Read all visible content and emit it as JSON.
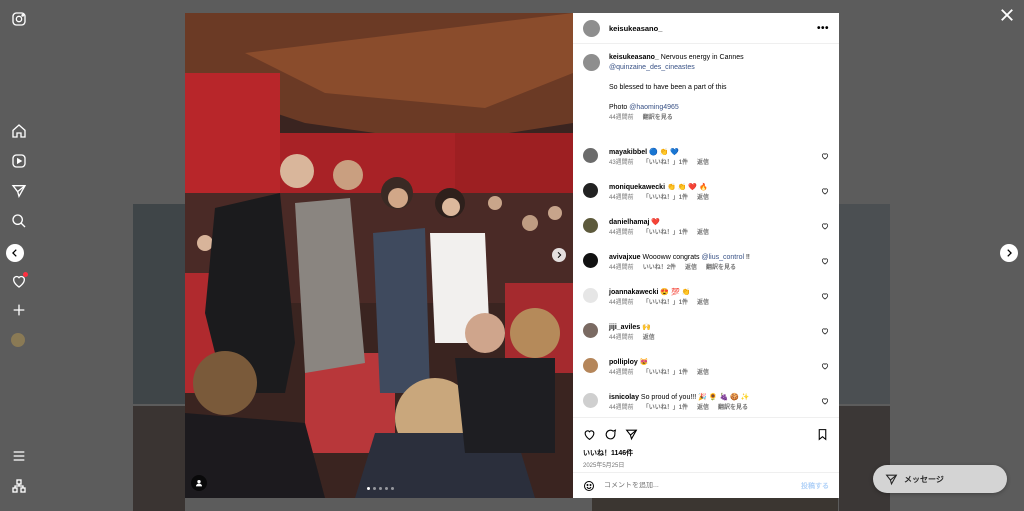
{
  "post": {
    "username": "keisukeasano_",
    "caption_lead": "Nervous energy in Cannes",
    "caption_mention": "@quinzaine_des_cineastes",
    "caption_line2": "So blessed to have been a part of this",
    "caption_photo_label": "Photo",
    "caption_photo_mention": "@haoming4965",
    "caption_time": "44週間前",
    "caption_translate": "翻訳を見る",
    "likes": "いいね！1146件",
    "date": "2025年5月25日"
  },
  "comments": [
    {
      "user": "mayakibbel",
      "text": "🔵 👏 💙",
      "time": "43週間前",
      "likes": "「いいね！」1件",
      "reply": "返信",
      "translate": "",
      "avatar_color": "#6b6b6b"
    },
    {
      "user": "moniquekawecki",
      "text": "👏 👏 ❤️ 🔥",
      "time": "44週間前",
      "likes": "「いいね！」1件",
      "reply": "返信",
      "translate": "",
      "avatar_color": "#222222"
    },
    {
      "user": "danielhamaj",
      "text": "❤️",
      "time": "44週間前",
      "likes": "「いいね！」1件",
      "reply": "返信",
      "translate": "",
      "avatar_color": "#5d5a3c"
    },
    {
      "user": "avivajxue",
      "text": "Woooww congrats",
      "mention": "@lius_control",
      "text_after": "!!",
      "time": "44週間前",
      "likes": "いいね！2件",
      "reply": "返信",
      "translate": "翻訳を見る",
      "avatar_color": "#111111"
    },
    {
      "user": "joannakawecki",
      "text": "😍 💯 👏",
      "time": "44週間前",
      "likes": "「いいね！」1件",
      "reply": "返信",
      "translate": "",
      "avatar_color": "#e6e6e6"
    },
    {
      "user": "jiji_aviles",
      "text": "🙌",
      "time": "44週間前",
      "likes": "",
      "reply": "返信",
      "translate": "",
      "avatar_color": "#7a6a62"
    },
    {
      "user": "polliploy",
      "text": "😻",
      "time": "44週間前",
      "likes": "「いいね！」1件",
      "reply": "返信",
      "translate": "",
      "avatar_color": "#b5865a"
    },
    {
      "user": "isnicolay",
      "text": "So proud of you!!! 🎉 🌻 🍇 🍪 ✨",
      "time": "44週間前",
      "likes": "「いいね！」1件",
      "reply": "返信",
      "translate": "翻訳を見る",
      "avatar_color": "#cfcfcf"
    }
  ],
  "composer": {
    "placeholder": "コメントを追加...",
    "post_label": "投稿する"
  },
  "messages_button": "メッセージ",
  "icons": {
    "rail": [
      "instagram-icon",
      "home-icon",
      "reels-icon",
      "explore-icon",
      "search-icon",
      "notifications-icon",
      "create-icon",
      "profile-avatar"
    ],
    "rail_bottom": [
      "menu-icon",
      "also-from-meta-icon"
    ]
  },
  "colors": {
    "link": "#385185",
    "muted": "#737373",
    "notification_dot": "#ff3040",
    "post_button_disabled": "#b3d3f8"
  },
  "carousel": {
    "total": 5,
    "active": 1
  }
}
